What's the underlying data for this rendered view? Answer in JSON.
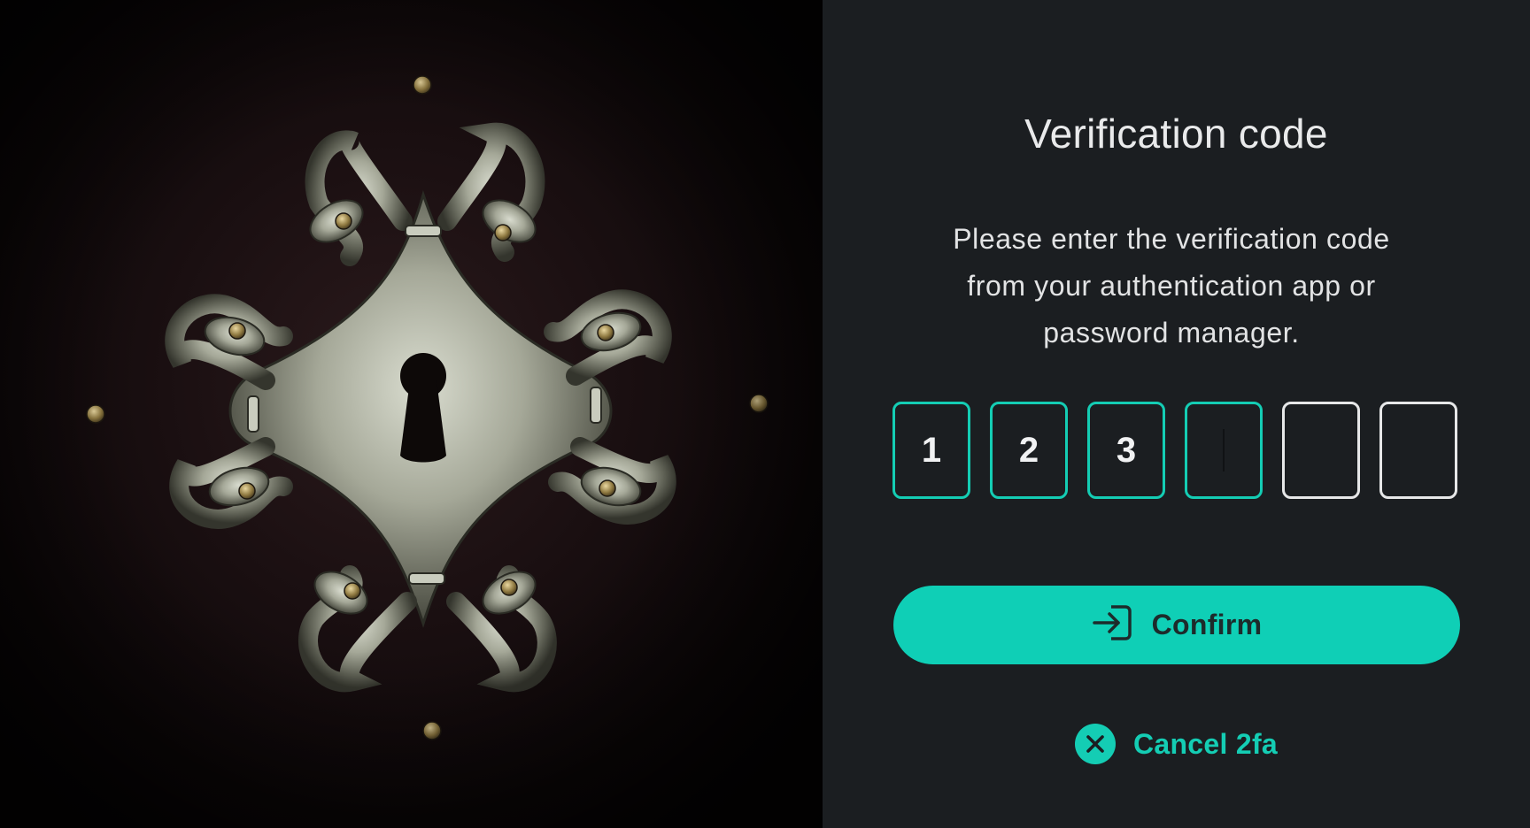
{
  "hero": {
    "image": "ornate-keyhole-escutcheon",
    "alt": ""
  },
  "verify": {
    "title": "Verification code",
    "description": "Please enter the verification code from your authentication app or password manager.",
    "code_digits": [
      "1",
      "2",
      "3",
      "",
      "",
      ""
    ],
    "active_index": 3
  },
  "actions": {
    "confirm_label": "Confirm",
    "confirm_icon": "login-arrow-icon",
    "cancel_label": "Cancel 2fa",
    "cancel_icon": "close-circle-icon"
  },
  "colors": {
    "accent": "#14cdb4",
    "panel_bg": "#1b1e21",
    "text": "#e6e7e8",
    "button_text": "#1d2b2b"
  }
}
